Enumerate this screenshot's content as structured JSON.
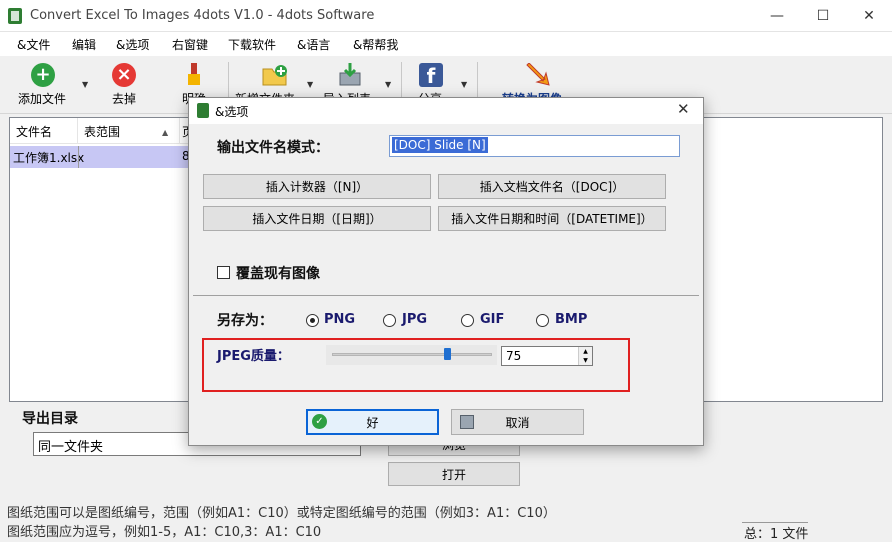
{
  "window": {
    "title": "Convert Excel To Images 4dots V1.0 - 4dots Software",
    "controls": {
      "minimize": "—",
      "maximize": "☐",
      "close": "✕"
    }
  },
  "menu": [
    "&文件",
    "编辑",
    "&选项",
    "右窗键",
    "下载软件",
    "&语言",
    "&帮帮我"
  ],
  "toolbar": {
    "add_file": "添加文件",
    "remove": "去掉",
    "clear": "明确",
    "new_folder": "新增文件夹",
    "import_list": "导入列表",
    "share": "分享",
    "convert": "转换为图像"
  },
  "table": {
    "headers": [
      "文件名",
      "表范围",
      "页"
    ],
    "rows": [
      {
        "file": "工作簿1.xlsx",
        "range": "",
        "page": "8"
      }
    ]
  },
  "output": {
    "title": "导出目录",
    "folder_value": "同一文件夹",
    "browse_label": "浏览",
    "open_label": "打开"
  },
  "hints": {
    "line1": "图纸范围可以是图纸编号，范围（例如A1：C10）或特定图纸编号的范围（例如3：A1：C10）",
    "line2": "图纸范围应为逗号，例如1-5，A1：C10,3：A1：C10"
  },
  "status": "总：1 文件",
  "dialog": {
    "title": "&选项",
    "close": "✕",
    "pattern_label": "输出文件名模式：",
    "pattern_value": "[DOC] Slide [N]",
    "buttons": {
      "insert_counter": "插入计数器（[N]）",
      "insert_doc_name": "插入文档文件名（[DOC]）",
      "insert_date": "插入文件日期（[日期]）",
      "insert_datetime": "插入文件日期和时间（[DATETIME]）"
    },
    "overwrite_label": "覆盖现有图像",
    "overwrite_checked": false,
    "save_as_label": "另存为：",
    "formats": [
      "PNG",
      "JPG",
      "GIF",
      "BMP"
    ],
    "selected_format": "PNG",
    "jpeg_quality_label": "JPEG质量：",
    "jpeg_quality": "75",
    "slider_fraction": 0.72,
    "ok": "好",
    "cancel": "取消"
  },
  "colors": {
    "highlight_box": "#e02020",
    "row_selected": "#c7c7f4",
    "ok_border": "#0a64d6"
  }
}
